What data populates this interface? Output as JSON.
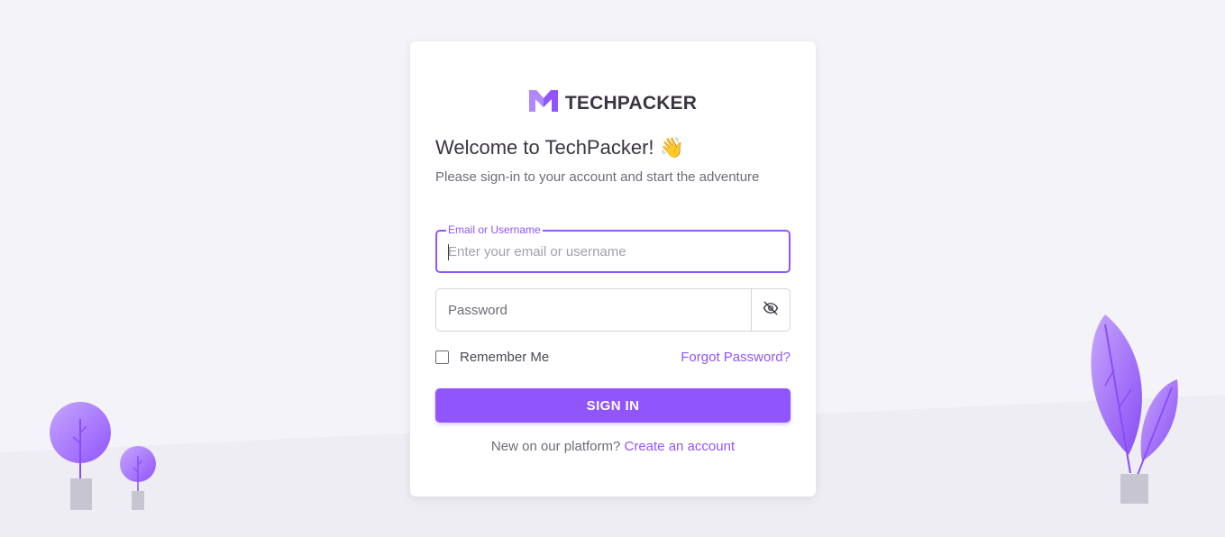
{
  "brand": {
    "name": "TECHPACKER",
    "logo_icon": "techpacker-m-logo-icon",
    "accent_color": "#9155fd"
  },
  "welcome": {
    "title": "Welcome to TechPacker!",
    "emoji": "👋",
    "subtitle": "Please sign-in to your account and start the adventure"
  },
  "form": {
    "email": {
      "label": "Email or Username",
      "placeholder": "Enter your email or username",
      "value": ""
    },
    "password": {
      "placeholder": "Password",
      "value": "",
      "toggle_icon": "eye-off-icon"
    },
    "remember_me": {
      "label": "Remember Me",
      "checked": false
    },
    "forgot_password": "Forgot Password?",
    "submit_label": "SIGN IN"
  },
  "footer": {
    "prompt": "New on our platform?",
    "create_account": "Create an account"
  },
  "colors": {
    "page_background": "#f4f4f8",
    "card_background": "#ffffff",
    "primary": "#9155fd",
    "text_primary": "#3a3541",
    "text_secondary": "#6f6b76",
    "tree_light": "#b088fb",
    "pot": "#c8c5d2"
  }
}
